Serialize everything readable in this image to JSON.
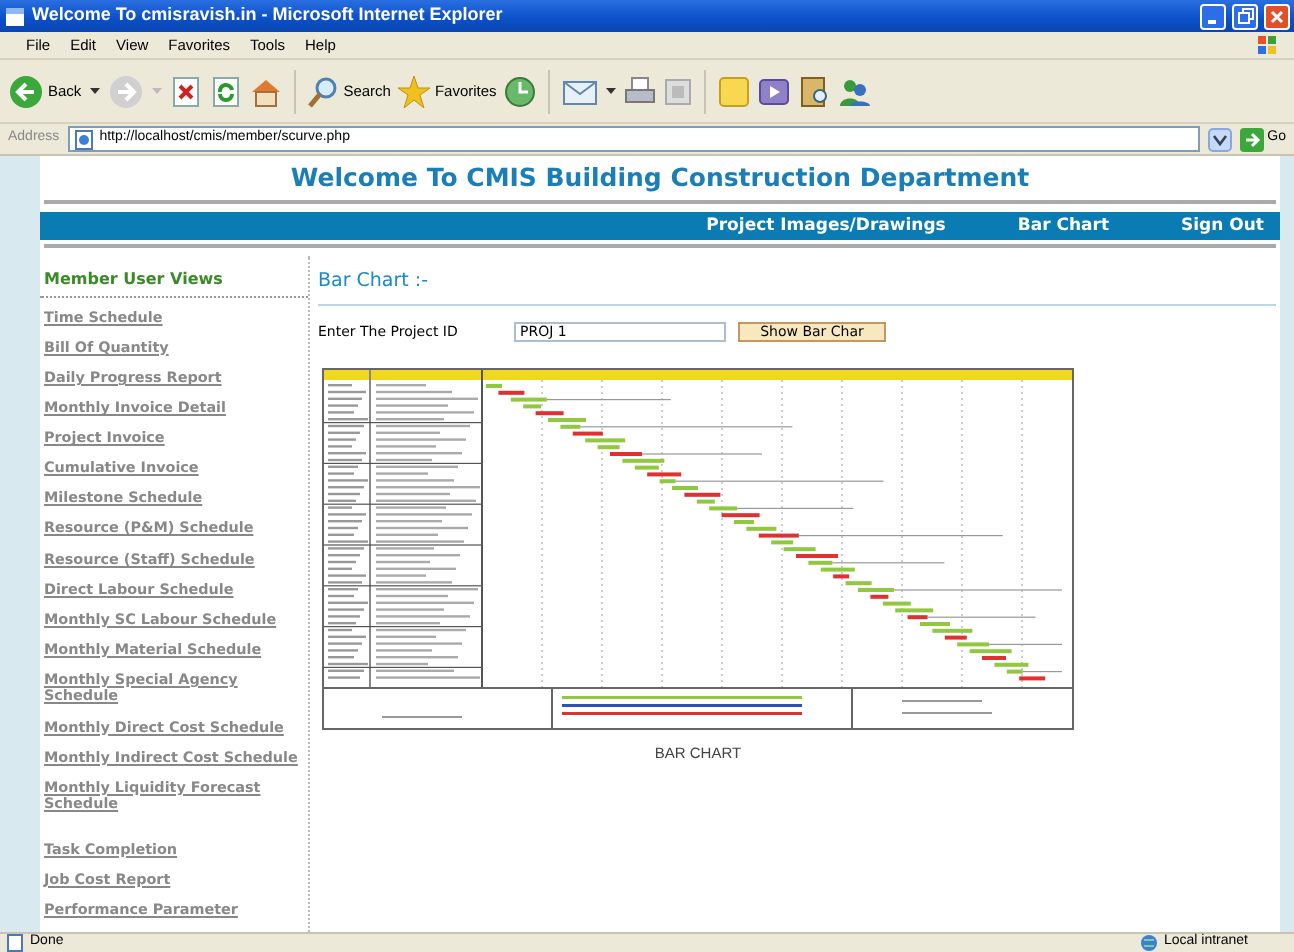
{
  "window": {
    "title": "Welcome To cmisravish.in - Microsoft Internet Explorer"
  },
  "menu": [
    "File",
    "Edit",
    "View",
    "Favorites",
    "Tools",
    "Help"
  ],
  "toolbar": {
    "back": "Back",
    "search": "Search",
    "favorites": "Favorites"
  },
  "address": {
    "label": "Address",
    "url": "http://localhost/cmis/member/scurve.php",
    "go": "Go"
  },
  "page": {
    "heading": "Welcome To CMIS Building Construction Department",
    "nav": [
      "Project Images/Drawings",
      "Bar Chart",
      "Sign Out"
    ],
    "sidebar": {
      "title": "Member User Views",
      "items": [
        "Time Schedule",
        "Bill Of Quantity",
        "Daily Progress Report",
        "Monthly Invoice Detail",
        "Project Invoice",
        "Cumulative Invoice",
        "Milestone Schedule",
        "Resource (P&M) Schedule",
        "Resource (Staff) Schedule",
        "Direct Labour Schedule",
        "Monthly SC Labour Schedule",
        "Monthly Material Schedule",
        "Monthly Special Agency Schedule",
        "Monthly Direct Cost Schedule",
        "Monthly Indirect Cost Schedule",
        "Monthly Liquidity Forecast Schedule",
        "Task Completion",
        "Job Cost Report",
        "Performance Parameter"
      ]
    },
    "content": {
      "title": "Bar Chart :-",
      "field_label": "Enter The Project ID",
      "project_id": "PROJ 1",
      "button": "Show Bar Char",
      "caption": "BAR CHART"
    }
  },
  "status_bar": {
    "left": "Done",
    "zone": "Local intranet"
  }
}
